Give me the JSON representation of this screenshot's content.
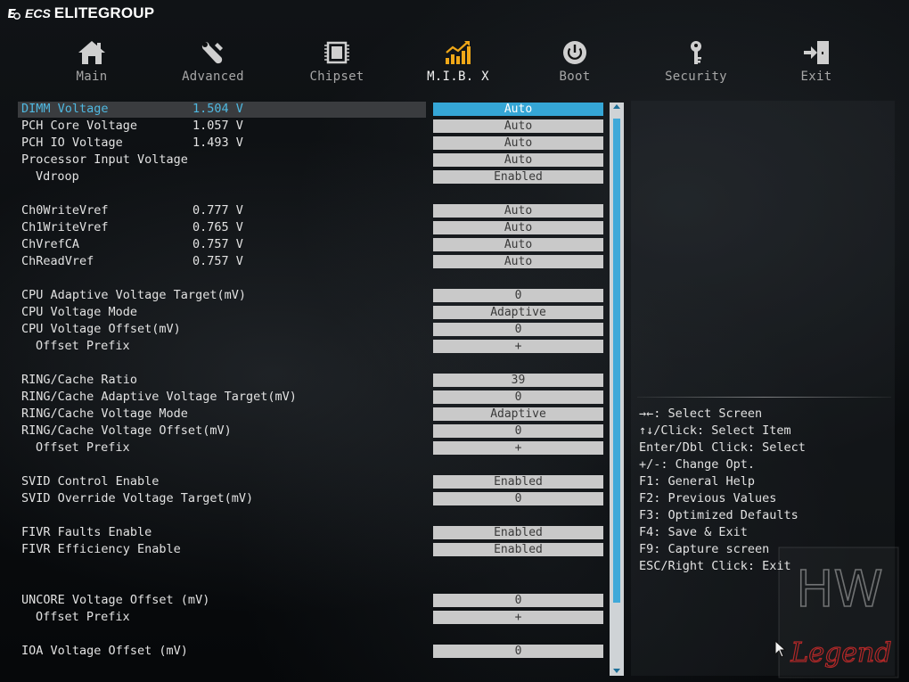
{
  "brand": {
    "logo": "ECS",
    "name": "ELITEGROUP"
  },
  "tabs": [
    {
      "label": "Main",
      "icon": "home-icon",
      "active": false
    },
    {
      "label": "Advanced",
      "icon": "wrench-icon",
      "active": false
    },
    {
      "label": "Chipset",
      "icon": "chip-icon",
      "active": false
    },
    {
      "label": "M.I.B. X",
      "icon": "bar-chart-icon",
      "active": true
    },
    {
      "label": "Boot",
      "icon": "power-icon",
      "active": false
    },
    {
      "label": "Security",
      "icon": "key-icon",
      "active": false
    },
    {
      "label": "Exit",
      "icon": "exit-icon",
      "active": false
    }
  ],
  "settings": [
    {
      "label": "DIMM Voltage",
      "value": "1.504 V",
      "option": "Auto",
      "highlighted": true
    },
    {
      "label": "PCH Core Voltage",
      "value": "1.057 V",
      "option": "Auto"
    },
    {
      "label": "PCH IO Voltage",
      "value": "1.493 V",
      "option": "Auto"
    },
    {
      "label": "Processor Input Voltage",
      "value": "",
      "option": "Auto"
    },
    {
      "label": "Vdroop",
      "value": "",
      "option": "Enabled",
      "sub": true
    },
    {
      "label": "Ch0WriteVref",
      "value": "0.777 V",
      "option": "Auto"
    },
    {
      "label": "Ch1WriteVref",
      "value": "0.765 V",
      "option": "Auto"
    },
    {
      "label": "ChVrefCA",
      "value": "0.757 V",
      "option": "Auto"
    },
    {
      "label": "ChReadVref",
      "value": "0.757 V",
      "option": "Auto"
    },
    {
      "label": "CPU Adaptive Voltage Target(mV)",
      "value": "",
      "option": "0"
    },
    {
      "label": "CPU Voltage Mode",
      "value": "",
      "option": "Adaptive"
    },
    {
      "label": "CPU Voltage Offset(mV)",
      "value": "",
      "option": "0"
    },
    {
      "label": "Offset Prefix",
      "value": "",
      "option": "+",
      "sub": true
    },
    {
      "label": "RING/Cache Ratio",
      "value": "",
      "option": "39"
    },
    {
      "label": "RING/Cache Adaptive Voltage Target(mV)",
      "value": "",
      "option": "0"
    },
    {
      "label": "RING/Cache Voltage Mode",
      "value": "",
      "option": "Adaptive"
    },
    {
      "label": "RING/Cache Voltage Offset(mV)",
      "value": "",
      "option": "0"
    },
    {
      "label": "Offset Prefix",
      "value": "",
      "option": "+",
      "sub": true
    },
    {
      "label": "SVID Control Enable",
      "value": "",
      "option": "Enabled"
    },
    {
      "label": "SVID Override Voltage Target(mV)",
      "value": "",
      "option": "0"
    },
    {
      "label": "FIVR Faults Enable",
      "value": "",
      "option": "Enabled"
    },
    {
      "label": "FIVR Efficiency Enable",
      "value": "",
      "option": "Enabled"
    },
    {
      "label": "UNCORE Voltage Offset (mV)",
      "value": "",
      "option": "0"
    },
    {
      "label": "Offset Prefix",
      "value": "",
      "option": "+",
      "sub": true
    },
    {
      "label": "IOA Voltage Offset (mV)",
      "value": "",
      "option": "0"
    }
  ],
  "help": [
    "→←: Select Screen",
    "↑↓/Click: Select Item",
    "Enter/Dbl Click: Select",
    "+/-: Change Opt.",
    "F1: General Help",
    "F2: Previous Values",
    "F3: Optimized Defaults",
    "F4: Save & Exit",
    "F9: Capture screen",
    "ESC/Right Click: Exit"
  ],
  "watermark": {
    "top": "HW",
    "bottom": "Legend"
  },
  "colors": {
    "accent": "#35a6d6",
    "highlight_text": "#4fb8e0",
    "option_bg": "#c9c9c9",
    "watermark_red": "#b02828"
  }
}
